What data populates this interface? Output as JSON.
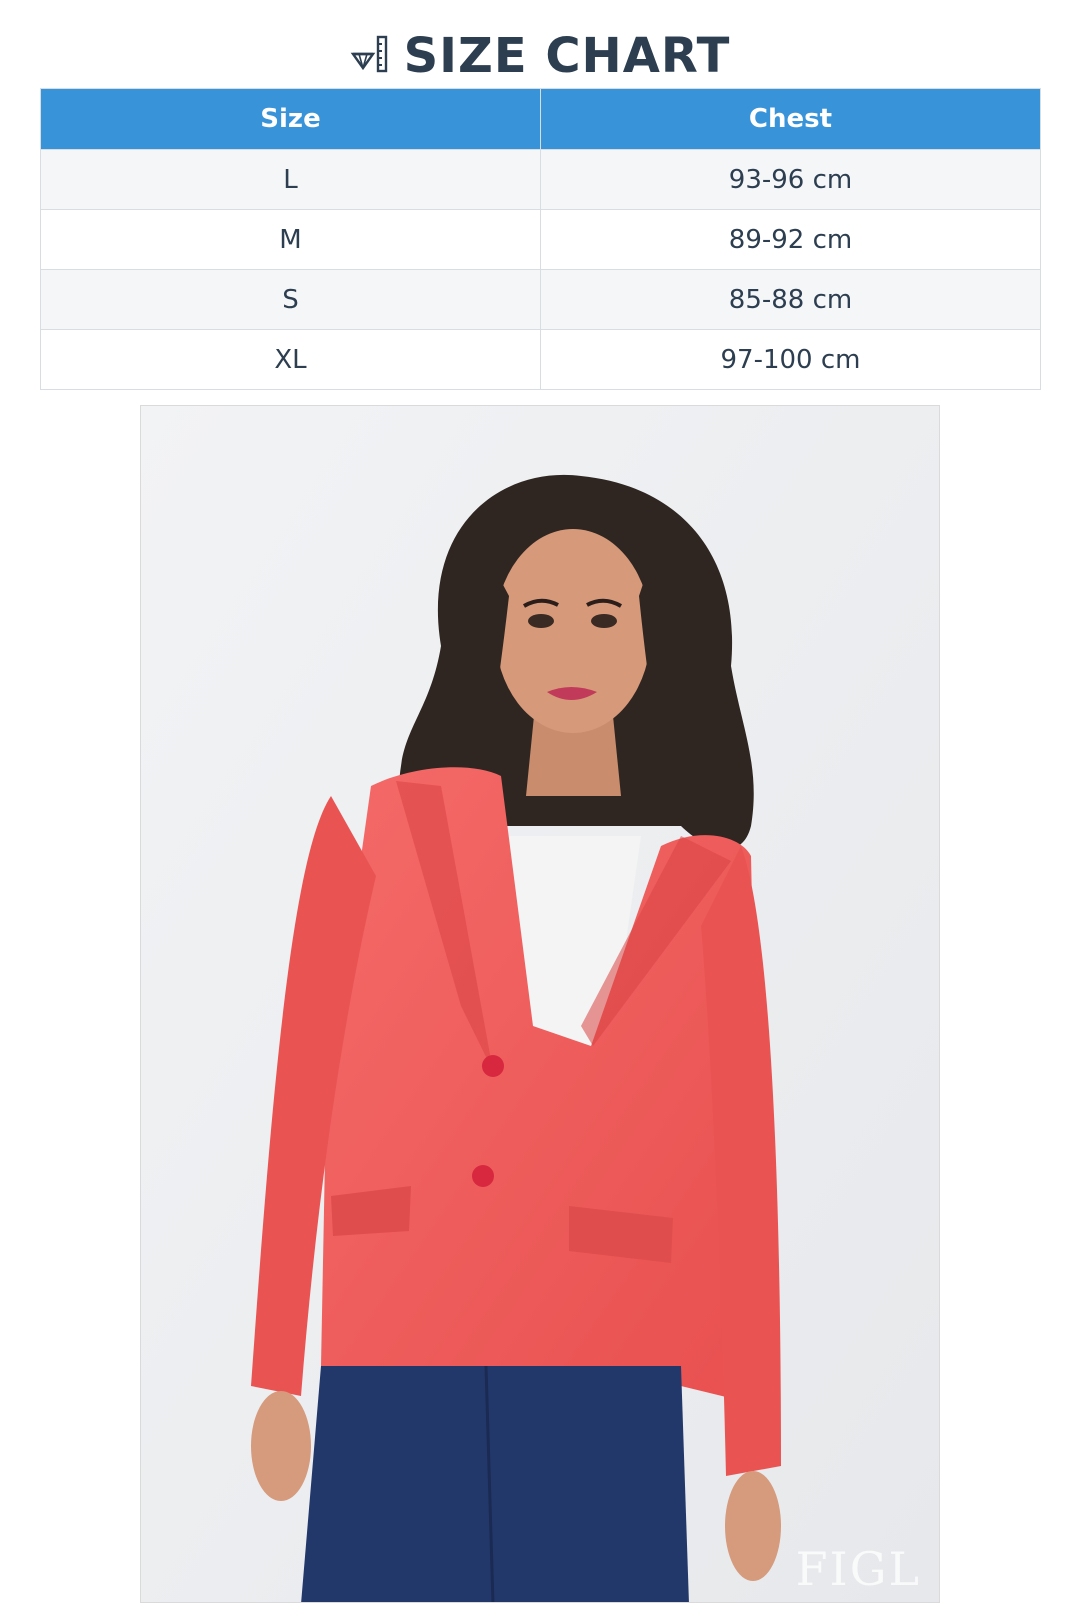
{
  "title": "SIZE CHART",
  "icons": {
    "title_icon": "ruler-diamond-icon"
  },
  "table": {
    "headers": [
      "Size",
      "Chest"
    ],
    "rows": [
      [
        "L",
        "93-96 cm"
      ],
      [
        "M",
        "89-92 cm"
      ],
      [
        "S",
        "85-88 cm"
      ],
      [
        "XL",
        "97-100 cm"
      ]
    ]
  },
  "colors": {
    "header_bg": "#3893d8",
    "title": "#2c3e50",
    "jacket": "#f05a5b"
  },
  "photo": {
    "watermark": "FIGL"
  }
}
